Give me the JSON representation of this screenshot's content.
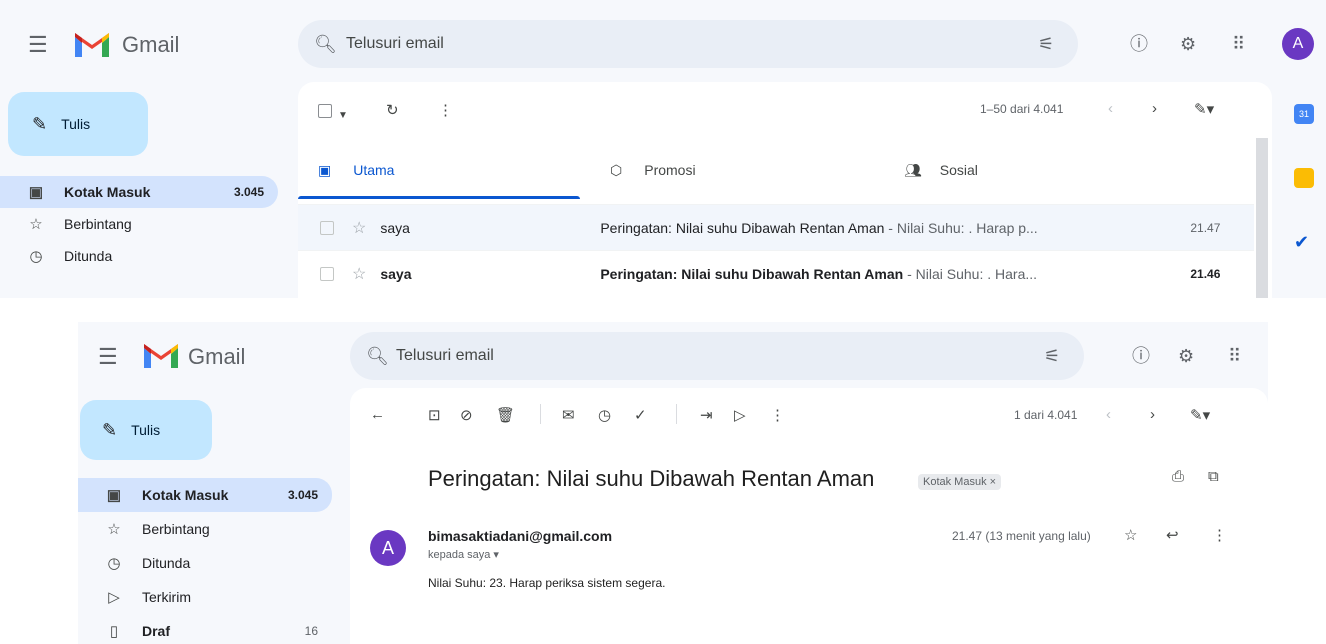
{
  "top": {
    "brand": "Gmail",
    "search_placeholder": "Telusuri email",
    "avatar_initial": "A",
    "compose_label": "Tulis",
    "nav": [
      {
        "label": "Kotak Masuk",
        "count": "3.045"
      },
      {
        "label": "Berbintang",
        "count": ""
      },
      {
        "label": "Ditunda",
        "count": ""
      }
    ],
    "pagination": "1–50 dari 4.041",
    "tabs": [
      {
        "label": "Utama"
      },
      {
        "label": "Promosi"
      },
      {
        "label": "Sosial"
      }
    ],
    "emails": [
      {
        "sender": "saya",
        "subject": "Peringatan: Nilai suhu Dibawah Rentan Aman",
        "snippet": " - Nilai Suhu: . Harap p...",
        "time": "21.47"
      },
      {
        "sender": "saya",
        "subject": "Peringatan: Nilai suhu Dibawah Rentan Aman",
        "snippet": " - Nilai Suhu: . Hara...",
        "time": "21.46"
      }
    ]
  },
  "bottom": {
    "brand": "Gmail",
    "search_placeholder": "Telusuri email",
    "compose_label": "Tulis",
    "nav": [
      {
        "label": "Kotak Masuk",
        "count": "3.045"
      },
      {
        "label": "Berbintang",
        "count": ""
      },
      {
        "label": "Ditunda",
        "count": ""
      },
      {
        "label": "Terkirim",
        "count": ""
      },
      {
        "label": "Draf",
        "count": "16"
      }
    ],
    "pagination": "1 dari 4.041",
    "message": {
      "subject": "Peringatan: Nilai suhu Dibawah Rentan Aman",
      "label_chip": "Kotak Masuk ×",
      "sender_initial": "A",
      "sender_email": "bimasaktiadani@gmail.com",
      "recipient": "kepada saya ▾",
      "timestamp": "21.47 (13 menit yang lalu)",
      "body": "Nilai Suhu: 23. Harap periksa sistem segera."
    }
  },
  "colors": {
    "accent": "#0b57d0",
    "compose_bg": "#c2e7ff",
    "active_nav": "#d3e3fd",
    "avatar": "#6a38c2"
  },
  "icons": [
    "menu-icon",
    "search-icon",
    "filter-icon",
    "help-icon",
    "settings-icon",
    "apps-icon",
    "pencil-icon",
    "inbox-icon",
    "star-icon",
    "clock-icon",
    "send-icon",
    "draft-icon",
    "refresh-icon",
    "more-icon",
    "back-icon",
    "archive-icon",
    "report-icon",
    "delete-icon",
    "mark-unread-icon",
    "snooze-icon",
    "add-task-icon",
    "move-icon",
    "label-icon",
    "print-icon",
    "open-new-icon",
    "reply-icon",
    "calendar-icon",
    "keep-icon",
    "tasks-icon"
  ]
}
